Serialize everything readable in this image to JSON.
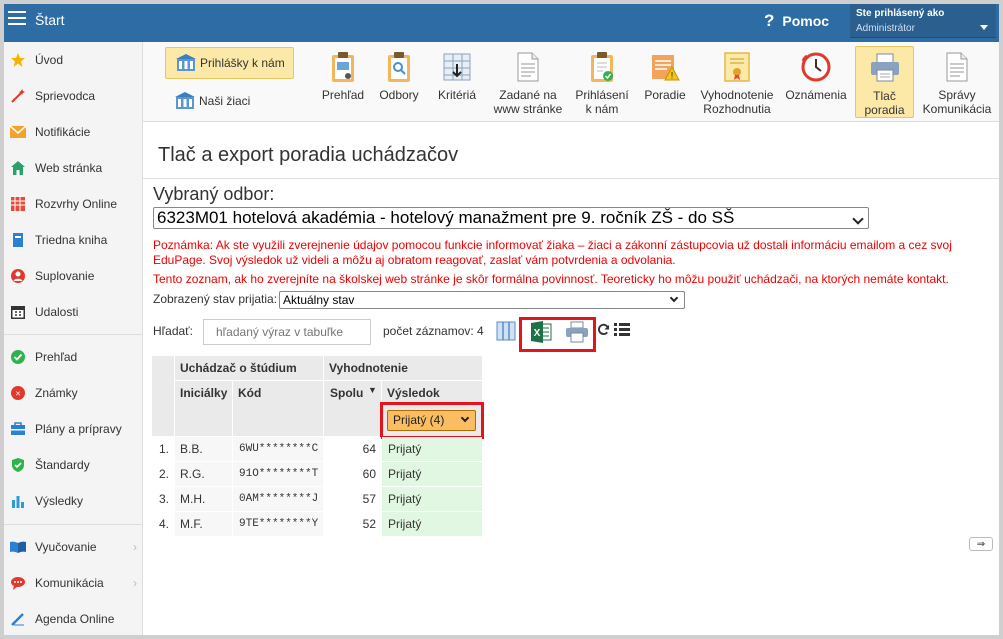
{
  "topbar": {
    "title": "Štart",
    "help_label": "Pomoc",
    "user_label": "Ste prihlásený ako",
    "user_name": "Administrátor"
  },
  "sidebar": {
    "items": [
      {
        "label": "Úvod",
        "icon": "star-icon"
      },
      {
        "label": "Sprievodca",
        "icon": "wand-icon"
      },
      {
        "label": "Notifikácie",
        "icon": "envelope-icon"
      },
      {
        "label": "Web stránka",
        "icon": "home-icon"
      },
      {
        "label": "Rozvrhy Online",
        "icon": "timetable-icon"
      },
      {
        "label": "Triedna kniha",
        "icon": "book-icon"
      },
      {
        "label": "Suplovanie",
        "icon": "person-icon"
      },
      {
        "label": "Udalosti",
        "icon": "calendar-icon"
      },
      {
        "label": "Prehľad",
        "icon": "check-circle-icon"
      },
      {
        "label": "Známky",
        "icon": "grade-icon"
      },
      {
        "label": "Plány a prípravy",
        "icon": "briefcase-icon"
      },
      {
        "label": "Štandardy",
        "icon": "shield-check-icon"
      },
      {
        "label": "Výsledky",
        "icon": "bar-chart-icon"
      },
      {
        "label": "Vyučovanie",
        "icon": "open-book-icon"
      },
      {
        "label": "Komunikácia",
        "icon": "chat-icon"
      },
      {
        "label": "Agenda Online",
        "icon": "pen-icon"
      }
    ]
  },
  "toolbar": {
    "left_buttons": [
      {
        "label": "Prihlášky k nám"
      },
      {
        "label": "Naši žiaci"
      }
    ],
    "buttons": [
      {
        "label_lines": [
          "Prehľad",
          ""
        ]
      },
      {
        "label_lines": [
          "Odbory",
          ""
        ]
      },
      {
        "label_lines": [
          "Kritériá",
          ""
        ]
      },
      {
        "label_lines": [
          "Zadané na",
          "www stránke"
        ]
      },
      {
        "label_lines": [
          "Prihlásení",
          "k nám"
        ]
      },
      {
        "label_lines": [
          "Poradie",
          ""
        ]
      },
      {
        "label_lines": [
          "Vyhodnotenie",
          "Rozhodnutia"
        ]
      },
      {
        "label_lines": [
          "Oznámenia",
          ""
        ]
      },
      {
        "label_lines": [
          "Tlač",
          "poradia"
        ]
      },
      {
        "label_lines": [
          "Správy",
          "Komunikácia"
        ]
      }
    ]
  },
  "main": {
    "title": "Tlač a export poradia uchádzačov",
    "odbor_label": "Vybraný odbor:",
    "odbor_value": "6323M01 hotelová akadémia - hotelový manažment pre 9. ročník ZŠ - do SŠ",
    "note1": "Poznámka: Ak ste využili zverejnenie údajov pomocou funkcie informovať žiaka – žiaci a zákonní zástupcovia už dostali informáciu emailom a cez svoj EduPage. Svoj výsledok už videli a môžu aj obratom reagovať, zaslať vám potvrdenia a odvolania.",
    "note2": "Tento zoznam, ak ho zverejníte na školskej web stránke je skôr formálna povinnosť. Teoreticky ho môžu použiť uchádzači, na ktorých nemáte kontakt.",
    "stav_label": "Zobrazený stav prijatia:",
    "stav_value": "Aktuálny stav",
    "search_label": "Hľadať:",
    "search_placeholder": "hľadaný výraz v tabuľke",
    "count_label": "počet záznamov: 4"
  },
  "table": {
    "group1": "Uchádzač o štúdium",
    "group2": "Vyhodnotenie",
    "col_initials": "Iniciálky",
    "col_code": "Kód",
    "col_total": "Spolu",
    "col_result": "Výsledok",
    "result_filter": "Prijatý (4)",
    "rows": [
      {
        "num": "1.",
        "initials": "B.B.",
        "code": "6WU********C",
        "total": "64",
        "result": "Prijatý"
      },
      {
        "num": "2.",
        "initials": "R.G.",
        "code": "91O********T",
        "total": "60",
        "result": "Prijatý"
      },
      {
        "num": "3.",
        "initials": "M.H.",
        "code": "0AM********J",
        "total": "57",
        "result": "Prijatý"
      },
      {
        "num": "4.",
        "initials": "M.F.",
        "code": "9TE********Y",
        "total": "52",
        "result": "Prijatý"
      }
    ]
  },
  "colors": {
    "topbar": "#2d6da3",
    "highlight": "#e5141c",
    "status_filter": "#fbbd62",
    "result_bg": "#e1f7e1"
  }
}
